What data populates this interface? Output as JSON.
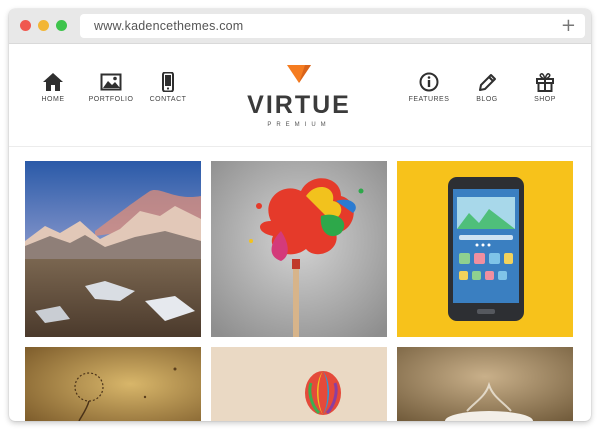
{
  "browser": {
    "url": "www.kadencethemes.com",
    "new_tab_label": "+"
  },
  "site": {
    "logo_title": "VIRTUE",
    "logo_subtitle": "PREMIUM",
    "accent_color": "#f57c20"
  },
  "nav_left": [
    {
      "label": "HOME",
      "icon": "home-icon"
    },
    {
      "label": "PORTFOLIO",
      "icon": "image-icon"
    },
    {
      "label": "CONTACT",
      "icon": "phone-icon"
    }
  ],
  "nav_right": [
    {
      "label": "FEATURES",
      "icon": "info-icon"
    },
    {
      "label": "BLOG",
      "icon": "pencil-icon"
    },
    {
      "label": "SHOP",
      "icon": "gift-icon"
    }
  ],
  "gallery": [
    {
      "subject": "snowy mountains at sunset",
      "bg": "#6a5a4a"
    },
    {
      "subject": "paint brush splash",
      "bg": "#b0b0b0"
    },
    {
      "subject": "smartphone illustration",
      "bg": "#f7c21b"
    },
    {
      "subject": "dandelion sepia",
      "bg": "#b8944f"
    },
    {
      "subject": "hot air balloon",
      "bg": "#e8d7c1"
    },
    {
      "subject": "coffee cup",
      "bg": "#a58a64"
    }
  ]
}
